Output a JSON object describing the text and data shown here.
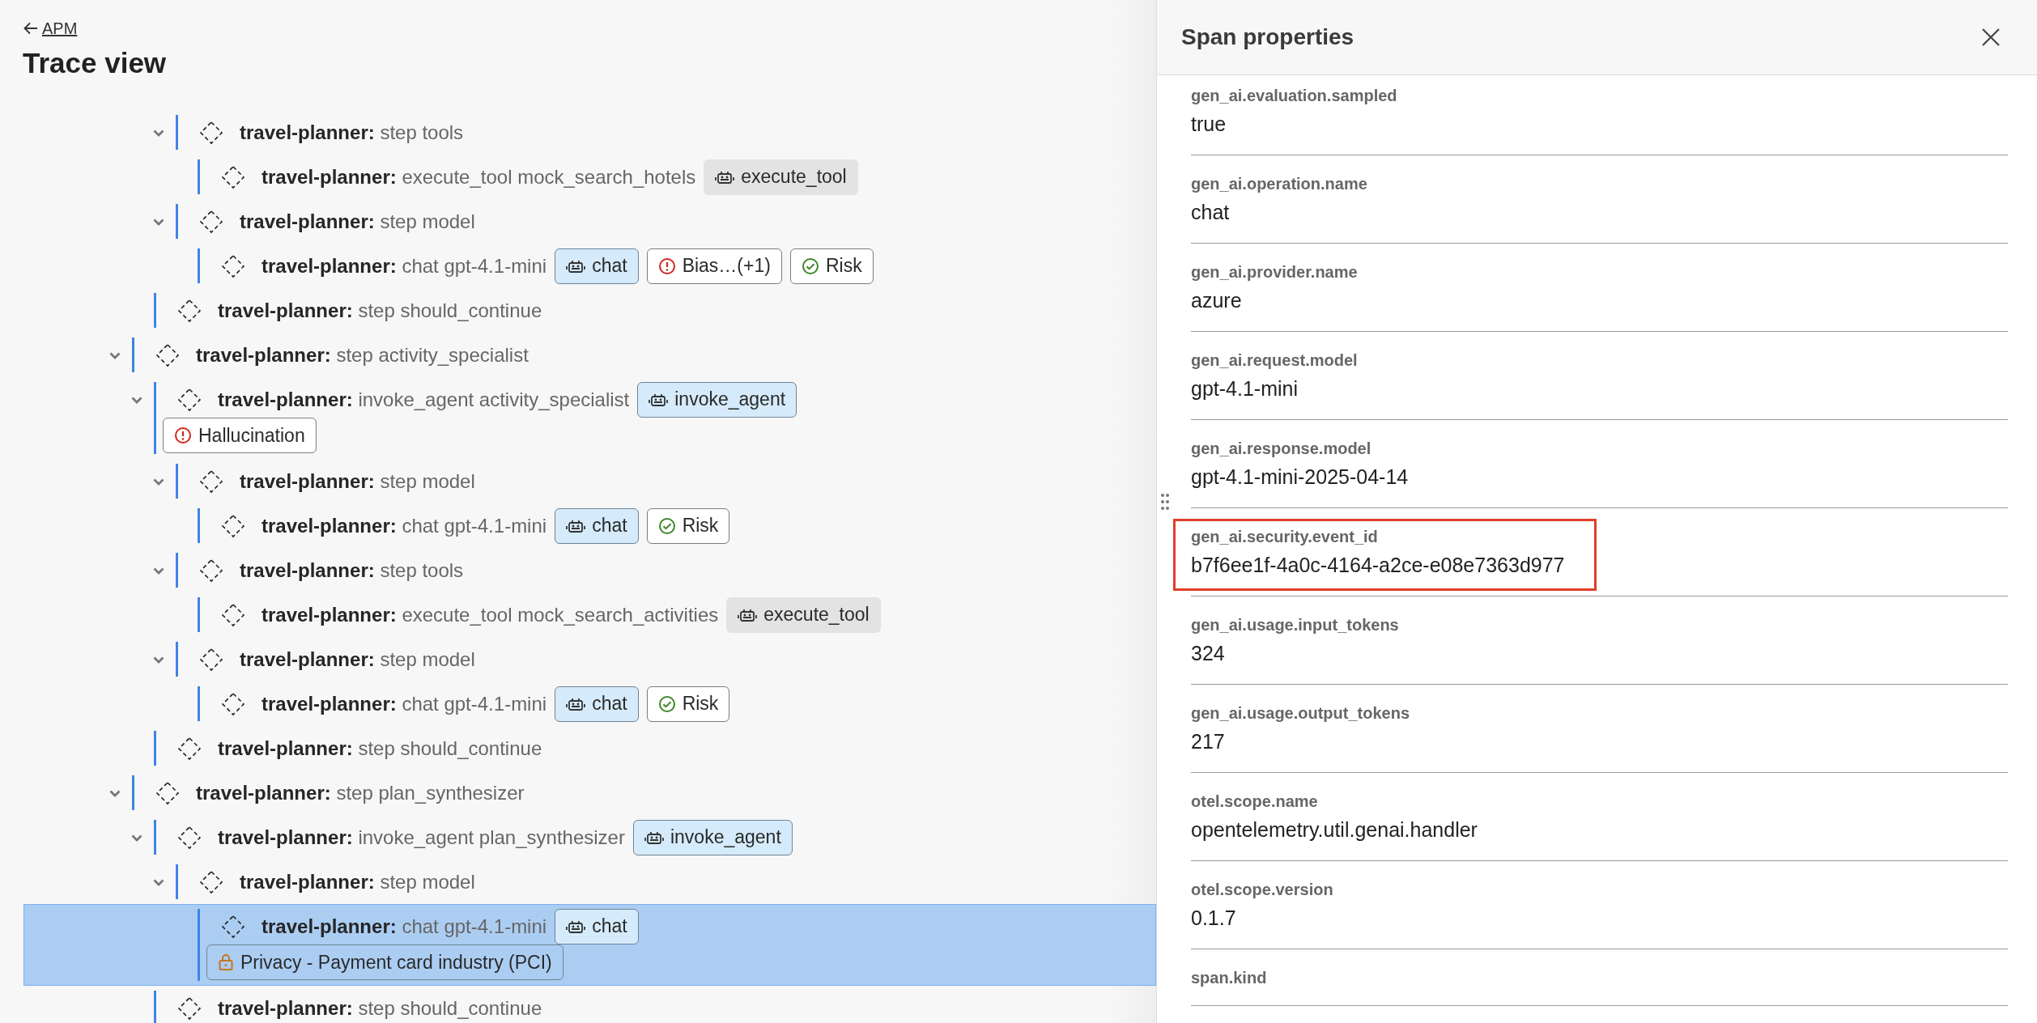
{
  "header": {
    "back_link": "APM",
    "title": "Trace view"
  },
  "spans": [
    {
      "children": [
        {
          "children": [
            {
              "label": "**travel-planner:** step tools",
              "selected": false,
              "expanded": true,
              "children": [
                {
                  "label": "**travel-planner:** execute_tool mock_search_hotels",
                  "selected": false,
                  "badges": [
                    {
                      "kind": "tool",
                      "text": "execute_tool"
                    }
                  ]
                }
              ]
            },
            {
              "label": "**travel-planner:** step model",
              "selected": false,
              "expanded": true,
              "children": [
                {
                  "label": "**travel-planner:** chat gpt-4.1-mini",
                  "selected": false,
                  "badges": [
                    {
                      "kind": "model",
                      "text": "chat"
                    },
                    {
                      "kind": "alert",
                      "text": "Bias…(+1)"
                    },
                    {
                      "kind": "pass",
                      "text": "Risk"
                    }
                  ]
                }
              ]
            }
          ]
        },
        {
          "label": "**travel-planner:** step should_continue",
          "selected": false
        }
      ]
    },
    {
      "label": "**travel-planner:** step activity_specialist",
      "selected": false,
      "expanded": true,
      "children": [
        {
          "label": "**travel-planner:** invoke_agent activity_specialist",
          "selected": false,
          "expanded": true,
          "badges": [
            {
              "kind": "model",
              "text": "invoke_agent"
            }
          ],
          "findings": [
            {
              "kind": "alert",
              "text": "Hallucination"
            }
          ],
          "children": [
            {
              "label": "**travel-planner:** step model",
              "selected": false,
              "expanded": true,
              "children": [
                {
                  "label": "**travel-planner:** chat gpt-4.1-mini",
                  "selected": false,
                  "badges": [
                    {
                      "kind": "model",
                      "text": "chat"
                    },
                    {
                      "kind": "pass",
                      "text": "Risk"
                    }
                  ]
                }
              ]
            },
            {
              "label": "**travel-planner:** step tools",
              "selected": false,
              "expanded": true,
              "children": [
                {
                  "label": "**travel-planner:** execute_tool mock_search_activities",
                  "selected": false,
                  "badges": [
                    {
                      "kind": "tool",
                      "text": "execute_tool"
                    }
                  ]
                }
              ]
            },
            {
              "label": "**travel-planner:** step model",
              "selected": false,
              "expanded": true,
              "children": [
                {
                  "label": "**travel-planner:** chat gpt-4.1-mini",
                  "selected": false,
                  "badges": [
                    {
                      "kind": "model",
                      "text": "chat"
                    },
                    {
                      "kind": "pass",
                      "text": "Risk"
                    }
                  ]
                }
              ]
            }
          ]
        },
        {
          "label": "**travel-planner:** step should_continue",
          "selected": false
        }
      ]
    },
    {
      "label": "**travel-planner:** step plan_synthesizer",
      "selected": false,
      "expanded": true,
      "children": [
        {
          "label": "**travel-planner:** invoke_agent plan_synthesizer",
          "selected": false,
          "expanded": true,
          "badges": [
            {
              "kind": "model",
              "text": "invoke_agent"
            }
          ],
          "children": [
            {
              "label": "**travel-planner:** step model",
              "selected": false,
              "expanded": true,
              "children": [
                {
                  "label": "**travel-planner:** chat gpt-4.1-mini",
                  "selected": true,
                  "badges": [
                    {
                      "kind": "model",
                      "text": "chat"
                    }
                  ],
                  "findings": [
                    {
                      "kind": "privacy",
                      "text": "Privacy - Payment card industry (PCI)"
                    }
                  ]
                }
              ]
            }
          ]
        },
        {
          "label": "**travel-planner:** step should_continue",
          "selected": false
        }
      ]
    }
  ],
  "properties_panel": {
    "title": "Span properties",
    "properties": [
      {
        "key": "gen_ai.evaluation.sampled",
        "value": "true",
        "highlighted": false
      },
      {
        "key": "gen_ai.operation.name",
        "value": "chat",
        "highlighted": false
      },
      {
        "key": "gen_ai.provider.name",
        "value": "azure",
        "highlighted": false
      },
      {
        "key": "gen_ai.request.model",
        "value": "gpt-4.1-mini",
        "highlighted": false
      },
      {
        "key": "gen_ai.response.model",
        "value": "gpt-4.1-mini-2025-04-14",
        "highlighted": false
      },
      {
        "key": "gen_ai.security.event_id",
        "value": "b7f6ee1f-4a0c-4164-a2ce-e08e7363d977",
        "highlighted": true
      },
      {
        "key": "gen_ai.usage.input_tokens",
        "value": "324",
        "highlighted": false
      },
      {
        "key": "gen_ai.usage.output_tokens",
        "value": "217",
        "highlighted": false
      },
      {
        "key": "otel.scope.name",
        "value": "opentelemetry.util.genai.handler",
        "highlighted": false
      },
      {
        "key": "otel.scope.version",
        "value": "0.1.7",
        "highlighted": false
      },
      {
        "key": "span.kind",
        "highlighted": false
      }
    ]
  }
}
